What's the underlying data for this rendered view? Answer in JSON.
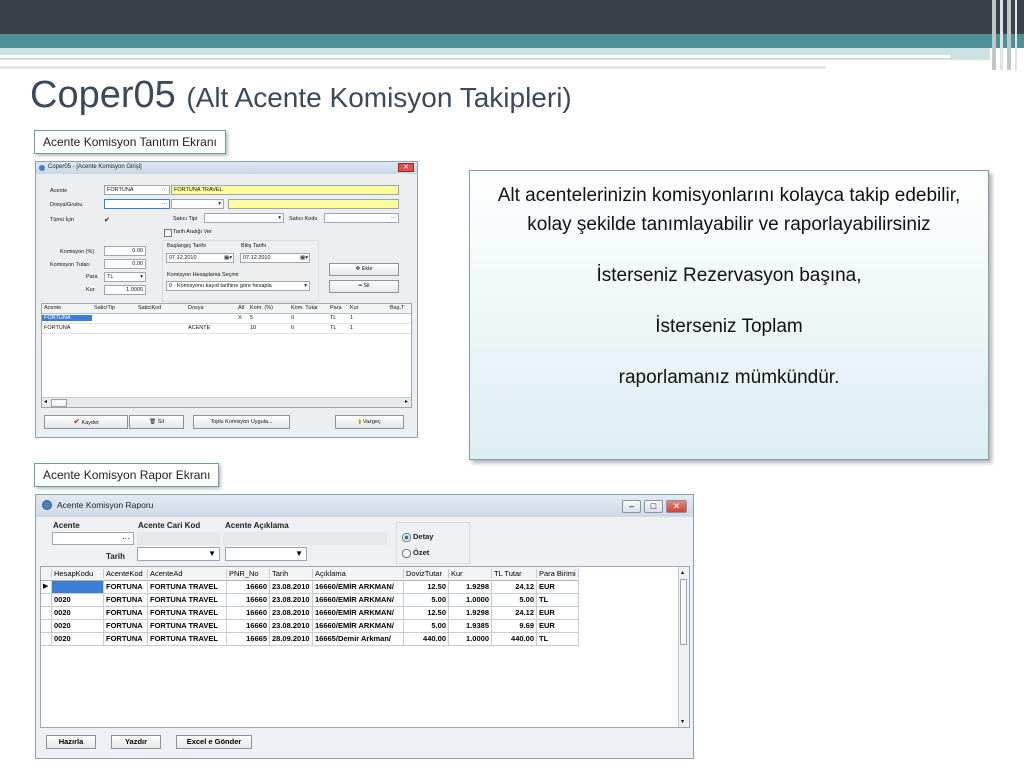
{
  "slide": {
    "title": "Coper05",
    "subtitle": "(Alt Acente Komisyon Takipleri)"
  },
  "captions": {
    "top": "Acente Komisyon Tanıtım Ekranı",
    "bottom": "Acente Komisyon Rapor Ekranı"
  },
  "info_box": {
    "line1": "Alt acentelerinizin komisyonlarını kolayca takip edebilir, kolay şekilde tanımlayabilir ve raporlayabilirsiniz",
    "line2": "İsterseniz Rezervasyon başına,",
    "line3": "İsterseniz Toplam",
    "line4": "raporlamanız mümkündür."
  },
  "window1": {
    "title": "Coper05 - [Acente Komisyon Girişi]",
    "labels": {
      "acente": "Acente",
      "dosya_grubu": "Dosya/Grubu",
      "tumu_icin": "Tümü İçin",
      "satici_tipi": "Satıcı Tipi",
      "satici_kodu": "Satıcı Kodu",
      "tarih_araligi": "Tarih Aralığı Ver",
      "komisyon_yuzde": "Komisyon (%)",
      "komisyon_tutari": "Komisyon Tutarı",
      "para": "Para",
      "kur": "Kur",
      "baslangic": "Başlangıç Tarihi",
      "bitis": "Bitiş Tarihi",
      "hesaplama": "Komisyon Hesaplama Seçimi"
    },
    "values": {
      "acente_code": "FORTUNA",
      "acente_name": "FORTUNA TRAVEL",
      "komisyon_yuzde": "0.00",
      "komisyon_tutari": "0.00",
      "para": "TL",
      "kur": "1.0000",
      "baslangic": "07.12.2010",
      "bitis": "07.12.2010",
      "hesaplama": "0 - Komisyonu kayıd tarihine göre hesapla",
      "dots": "···"
    },
    "buttons": {
      "ekle": "Ekle",
      "sil_side": "Sil",
      "kaydet": "Kaydet",
      "sil": "Sil",
      "toplu": "Toplu Komisyon Uygula...",
      "vazgec": "Vazgeç"
    },
    "table": {
      "columns": [
        "Acente",
        "SaticiTip",
        "SaticiKod",
        "Dosya",
        "All",
        "Kom. (%)",
        "Kom. Tutar",
        "Para",
        "Kur",
        "Baş.T"
      ],
      "rows": [
        [
          "FORTUNA",
          "",
          "",
          "",
          "X",
          "5",
          "0",
          "TL",
          "1",
          ""
        ],
        [
          "FORTUNA",
          "",
          "",
          "ACENTE",
          "",
          "10",
          "0",
          "TL",
          "1",
          ""
        ]
      ]
    }
  },
  "window2": {
    "title": "Acente Komisyon Raporu",
    "labels": {
      "acente": "Acente",
      "cari_kod": "Acente Cari Kod",
      "aciklama": "Acente Açıklama",
      "tarih": "Tarih",
      "detay": "Detay",
      "ozet": "Özet"
    },
    "dots": "···",
    "buttons": {
      "hazirla": "Hazırla",
      "yazdir": "Yazdır",
      "excel": "Excel e Gönder"
    },
    "table": {
      "columns": [
        "HesapKodu",
        "AcenteKod",
        "AcenteAd",
        "PNR_No",
        "Tarih",
        "Açıklama",
        "DovizTutar",
        "Kur",
        "TL Tutar",
        "Para Birimi"
      ],
      "rows": [
        [
          "",
          "FORTUNA",
          "FORTUNA TRAVEL",
          "16660",
          "23.08.2010",
          "16660/EMİR ARKMAN/",
          "12.50",
          "1.9298",
          "24.12",
          "EUR"
        ],
        [
          "0020",
          "FORTUNA",
          "FORTUNA TRAVEL",
          "16660",
          "23.08.2010",
          "16660/EMİR ARKMAN/",
          "5.00",
          "1.0000",
          "5.00",
          "TL"
        ],
        [
          "0020",
          "FORTUNA",
          "FORTUNA TRAVEL",
          "16660",
          "23.08.2010",
          "16660/EMİR ARKMAN/",
          "12.50",
          "1.9298",
          "24.12",
          "EUR"
        ],
        [
          "0020",
          "FORTUNA",
          "FORTUNA TRAVEL",
          "16660",
          "23.08.2010",
          "16660/EMİR ARKMAN/",
          "5.00",
          "1.9385",
          "9.69",
          "EUR"
        ],
        [
          "0020",
          "FORTUNA",
          "FORTUNA TRAVEL",
          "16665",
          "28.09.2010",
          "16665/Demir Arkman/",
          "440.00",
          "1.0000",
          "440.00",
          "TL"
        ]
      ]
    }
  },
  "colors": {
    "banner_dark": "#3c4149",
    "banner_teal": "#4d9096",
    "title_text": "#3a4a5c",
    "field_yellow": "#fdfd9e",
    "selected_row": "#3b7fd4"
  }
}
